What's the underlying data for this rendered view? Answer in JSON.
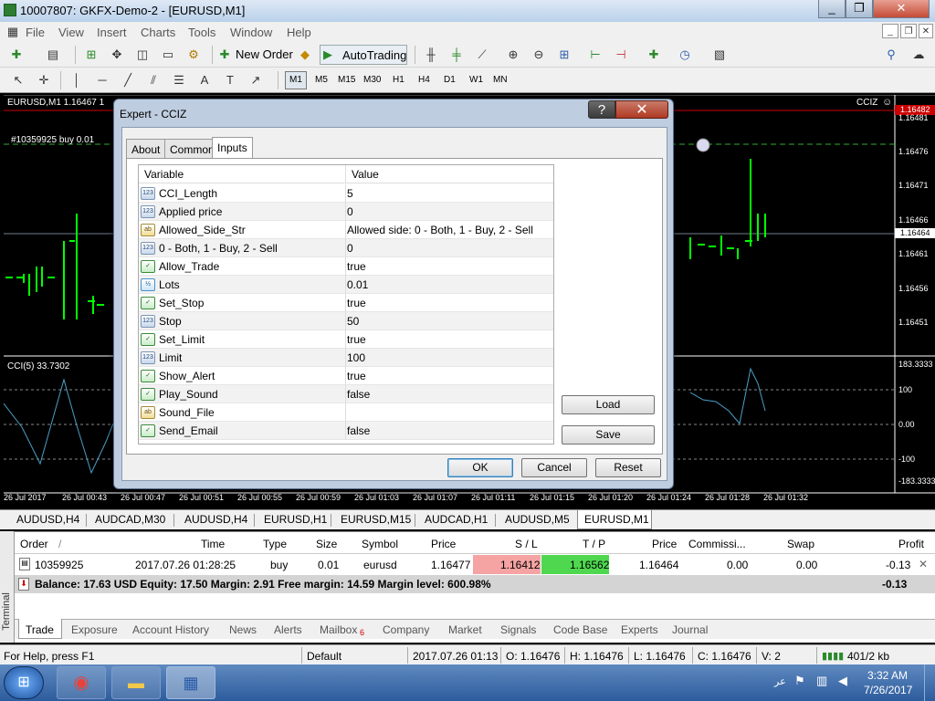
{
  "window": {
    "title": "10007807: GKFX-Demo-2 - [EURUSD,M1]",
    "min": "_",
    "max": "❐",
    "close": "✕"
  },
  "menu": [
    "File",
    "View",
    "Insert",
    "Charts",
    "Tools",
    "Window",
    "Help"
  ],
  "toolbar": {
    "new_order": "New Order",
    "autotrading": "AutoTrading",
    "timeframes": [
      "M1",
      "M5",
      "M15",
      "M30",
      "H1",
      "H4",
      "D1",
      "W1",
      "MN"
    ]
  },
  "chart": {
    "symbol_label": "EURUSD,M1  1.16467 1",
    "order_label": "#10359925 buy 0.01",
    "ea_label": "CCIZ",
    "indicator_label": "CCI(5) 33.7302",
    "price_labels": [
      "1.16482",
      "1.16481",
      "1.16476",
      "1.16471",
      "1.16466",
      "1.16464",
      "1.16461",
      "1.16456",
      "1.16451"
    ],
    "cci_labels": [
      "183.3333",
      "100",
      "0.00",
      "-100",
      "-183.3333"
    ],
    "time_labels": [
      "26 Jul 2017",
      "26 Jul 00:43",
      "26 Jul 00:47",
      "26 Jul 00:51",
      "26 Jul 00:55",
      "26 Jul 00:59",
      "26 Jul 01:03",
      "26 Jul 01:07",
      "26 Jul 01:11",
      "26 Jul 01:15",
      "26 Jul 01:20",
      "26 Jul 01:24",
      "26 Jul 01:28",
      "26 Jul 01:32"
    ]
  },
  "chart_tabs": [
    "AUDUSD,H4",
    "AUDCAD,M30",
    "AUDUSD,H4",
    "EURUSD,H1",
    "EURUSD,M15",
    "AUDCAD,H1",
    "AUDUSD,M5",
    "EURUSD,M1"
  ],
  "dialog": {
    "title": "Expert - CCIZ",
    "help": "?",
    "close": "✕",
    "tabs": [
      "About",
      "Common",
      "Inputs"
    ],
    "col_variable": "Variable",
    "col_value": "Value",
    "params": [
      {
        "icon": "123",
        "name": "CCI_Length",
        "value": "5"
      },
      {
        "icon": "123",
        "name": "Applied price",
        "value": "0"
      },
      {
        "icon": "ab",
        "name": "Allowed_Side_Str",
        "value": "Allowed side: 0 - Both, 1 - Buy, 2 - Sell"
      },
      {
        "icon": "123",
        "name": "0 - Both, 1 - Buy, 2 - Sell",
        "value": "0"
      },
      {
        "icon": "bool",
        "name": "Allow_Trade",
        "value": "true"
      },
      {
        "icon": "frac",
        "name": "Lots",
        "value": "0.01"
      },
      {
        "icon": "bool",
        "name": "Set_Stop",
        "value": "true"
      },
      {
        "icon": "123",
        "name": "Stop",
        "value": "50"
      },
      {
        "icon": "bool",
        "name": "Set_Limit",
        "value": "true"
      },
      {
        "icon": "123",
        "name": "Limit",
        "value": "100"
      },
      {
        "icon": "bool",
        "name": "Show_Alert",
        "value": "true"
      },
      {
        "icon": "bool",
        "name": "Play_Sound",
        "value": "false"
      },
      {
        "icon": "ab",
        "name": "Sound_File",
        "value": ""
      },
      {
        "icon": "bool",
        "name": "Send_Email",
        "value": "false"
      }
    ],
    "load": "Load",
    "save": "Save",
    "ok": "OK",
    "cancel": "Cancel",
    "reset": "Reset"
  },
  "terminal": {
    "headers": [
      "Order",
      "/",
      "Time",
      "Type",
      "Size",
      "Symbol",
      "Price",
      "S / L",
      "T / P",
      "Price",
      "Commissi...",
      "Swap",
      "Profit"
    ],
    "row": {
      "order": "10359925",
      "time": "2017.07.26 01:28:25",
      "type": "buy",
      "size": "0.01",
      "symbol": "eurusd",
      "price": "1.16477",
      "sl": "1.16412",
      "tp": "1.16562",
      "cur_price": "1.16464",
      "commission": "0.00",
      "swap": "0.00",
      "profit": "-0.13"
    },
    "balance_line": "Balance: 17.63 USD  Equity: 17.50  Margin: 2.91  Free margin: 14.59  Margin level: 600.98%",
    "balance_profit": "-0.13",
    "side_label": "Terminal",
    "tabs": [
      "Trade",
      "Exposure",
      "Account History",
      "News",
      "Alerts",
      "Mailbox",
      "Company",
      "Market",
      "Signals",
      "Code Base",
      "Experts",
      "Journal"
    ],
    "mailbox_count": "6"
  },
  "status": {
    "help": "For Help, press F1",
    "profile": "Default",
    "time": "2017.07.26 01:13",
    "o": "O: 1.16476",
    "h": "H: 1.16476",
    "l": "L: 1.16476",
    "c": "C: 1.16476",
    "v": "V: 2",
    "traffic": "401/2 kb"
  },
  "taskbar": {
    "time": "3:32 AM",
    "date": "7/26/2017"
  }
}
